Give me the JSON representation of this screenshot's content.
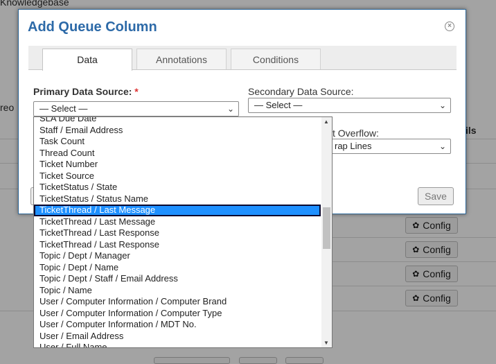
{
  "background": {
    "top_text": "Knowledgebase",
    "left_fragment": "reo",
    "right_fragment": "ils",
    "config_label": "Config"
  },
  "dialog": {
    "title": "Add Queue Column",
    "tabs": [
      {
        "label": "Data",
        "active": true
      },
      {
        "label": "Annotations",
        "active": false
      },
      {
        "label": "Conditions",
        "active": false
      }
    ],
    "primary_label": "Primary Data Source:",
    "required_mark": "*",
    "primary_value": "— Select —",
    "secondary_label": "Secondary Data Source:",
    "secondary_value": "— Select —",
    "overflow_label": "t Overflow:",
    "overflow_value": "rap Lines",
    "save_label": "Save"
  },
  "dropdown": {
    "items": [
      "SLA Due Date",
      "Staff / Email Address",
      "Task Count",
      "Thread Count",
      "Ticket Number",
      "Ticket Source",
      "TicketStatus / State",
      "TicketStatus / Status Name",
      "TicketThread / Last Message",
      "TicketThread / Last Message",
      "TicketThread / Last Response",
      "TicketThread / Last Response",
      "Topic / Dept / Manager",
      "Topic / Dept / Name",
      "Topic / Dept / Staff / Email Address",
      "Topic / Name",
      "User / Computer Information / Computer Brand",
      "User / Computer Information / Computer Type",
      "User / Computer Information / MDT No.",
      "User / Email Address",
      "User / Full Name"
    ],
    "selected_index": 8
  },
  "icons": {
    "close": "close-icon",
    "gear": "gear-icon",
    "chevron": "chevron-down-icon"
  }
}
